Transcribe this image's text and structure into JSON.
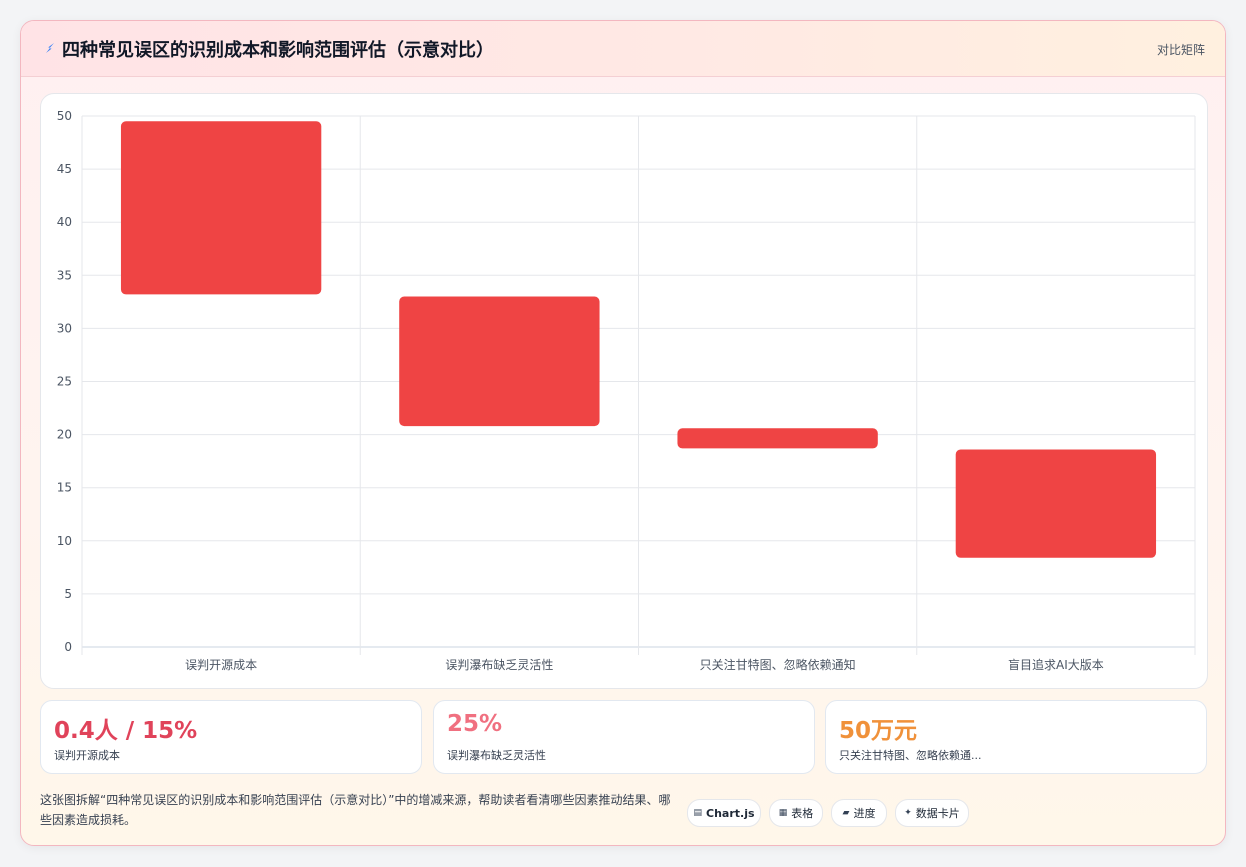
{
  "header": {
    "title": "四种常见误区的识别成本和影响范围评估（示意对比）",
    "tag": "对比矩阵"
  },
  "chart_data": {
    "type": "bar",
    "categories": [
      "误判开源成本",
      "误判瀑布缺乏灵活性",
      "只关注甘特图、忽略依赖通知",
      "盲目追求AI大版本"
    ],
    "ranges": [
      [
        33.2,
        49.5
      ],
      [
        20.8,
        33.0
      ],
      [
        18.7,
        20.6
      ],
      [
        8.4,
        18.6
      ]
    ],
    "ylim": [
      0,
      50
    ],
    "yticks": [
      0,
      5,
      10,
      15,
      20,
      25,
      30,
      35,
      40,
      45,
      50
    ],
    "grid": true,
    "bar_color": "#ef4444"
  },
  "stats": [
    {
      "value": "0.4人 / 15%",
      "label": "误判开源成本",
      "color": "#e0435a"
    },
    {
      "value": "25%",
      "label": "误判瀑布缺乏灵活性",
      "color": "#f07080"
    },
    {
      "value": "50万元",
      "label": "只关注甘特图、忽略依赖通...",
      "color": "#f0913a"
    }
  ],
  "description": "这张图拆解“四种常见误区的识别成本和影响范围评估（示意对比）”中的增减来源，帮助读者看清哪些因素推动结果、哪些因素造成损耗。",
  "pills": [
    {
      "icon": "chart-icon",
      "glyph": "▤",
      "label": "Chart.js"
    },
    {
      "icon": "table-icon",
      "glyph": "▦",
      "label": "表格"
    },
    {
      "icon": "progress-icon",
      "glyph": "▰",
      "label": "进度"
    },
    {
      "icon": "sparkle-icon",
      "glyph": "✦",
      "label": "数据卡片"
    }
  ]
}
